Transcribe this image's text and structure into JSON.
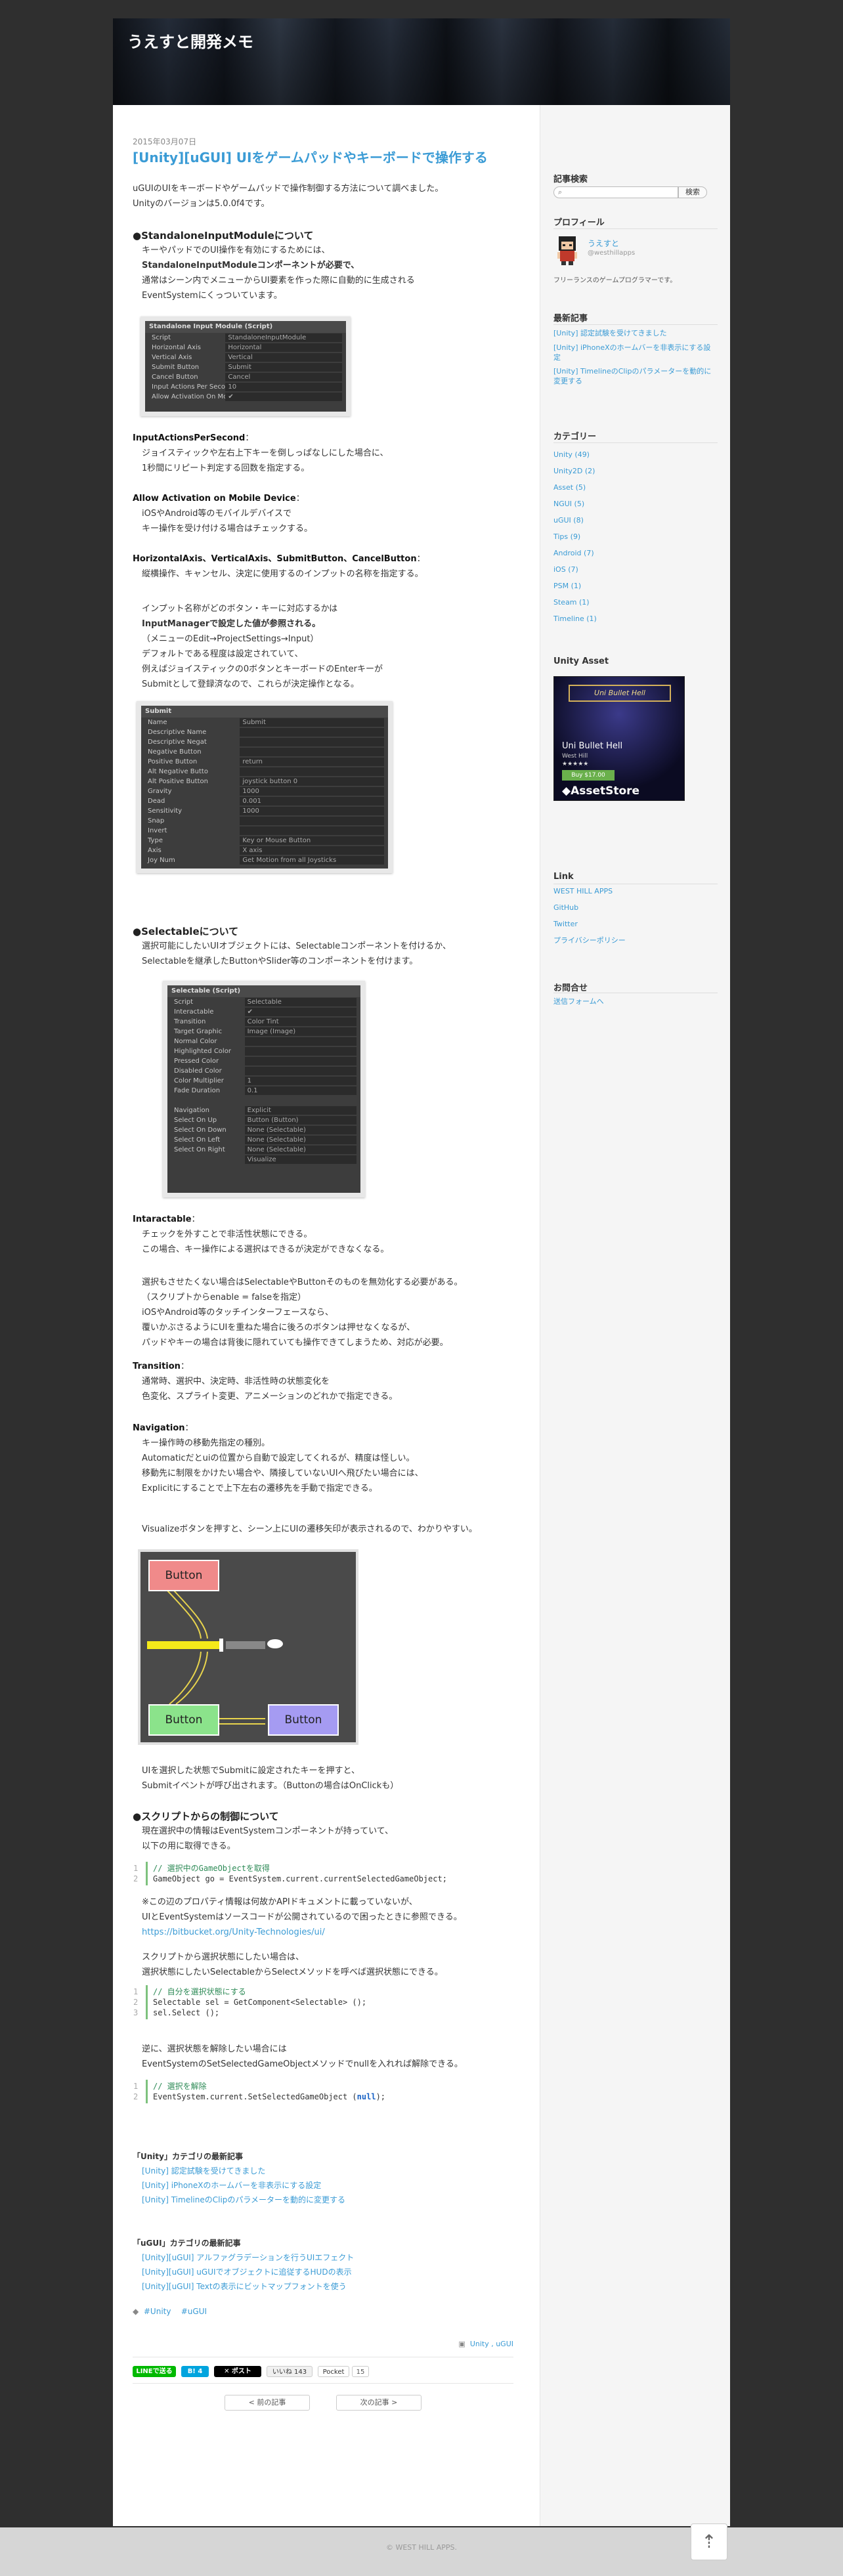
{
  "site": {
    "title": "うえすと開発メモ"
  },
  "post": {
    "date": "2015年03月07日",
    "title": "[Unity][uGUI] UIをゲームパッドやキーボードで操作する",
    "intro": [
      "uGUIのUIをキーボードやゲームパッドで操作制御する方法について調べました。",
      "Unityのバージョンは5.0.0f4です。"
    ],
    "sec1": {
      "heading": "●StandaloneInputModuleについて",
      "lines": [
        "キーやパッドでのUI操作を有効にするためには、",
        "StandaloneInputModuleコンポーネントが必要で、",
        "通常はシーン内でメニューからUI要素を作った際に自動的に生成される",
        "EventSystemにくっついています。"
      ]
    },
    "inspector1": {
      "title": "Standalone Input Module (Script)",
      "rows": [
        [
          "Script",
          "StandaloneInputModule"
        ],
        [
          "Horizontal Axis",
          "Horizontal"
        ],
        [
          "Vertical Axis",
          "Vertical"
        ],
        [
          "Submit Button",
          "Submit"
        ],
        [
          "Cancel Button",
          "Cancel"
        ],
        [
          "Input Actions Per Secon",
          "10"
        ],
        [
          "Allow Activation On Mo",
          "✔"
        ]
      ]
    },
    "desc1": {
      "label": "InputActionsPerSecond",
      "lines": [
        "ジョイスティックや左右上下キーを倒しっぱなしにした場合に、",
        "1秒間にリピート判定する回数を指定する。"
      ]
    },
    "desc2": {
      "label": "Allow Activation on Mobile Device",
      "lines": [
        "iOSやAndroid等のモバイルデバイスで",
        "キー操作を受け付ける場合はチェックする。"
      ]
    },
    "desc3": {
      "label": "HorizontalAxis、VerticalAxis、SubmitButton、CancelButton",
      "lines": [
        "縦横操作、キャンセル、決定に使用するのインプットの名称を指定する。"
      ]
    },
    "desc3b": {
      "lines": [
        "インプット名称がどのボタン・キーに対応するかは",
        "InputManagerで設定した値が参照される。",
        "（メニューのEdit→ProjectSettings→Input）",
        "デフォルトである程度は設定されていて、",
        "例えばジョイスティックの0ボタンとキーボードのEnterキーが",
        "Submitとして登録済なので、これらが決定操作となる。"
      ]
    },
    "inspector2": {
      "title": "Submit",
      "rows": [
        [
          "Name",
          "Submit"
        ],
        [
          "Descriptive Name",
          ""
        ],
        [
          "Descriptive Negat",
          ""
        ],
        [
          "Negative Button",
          ""
        ],
        [
          "Positive Button",
          "return"
        ],
        [
          "Alt Negative Butto",
          ""
        ],
        [
          "Alt Positive Button",
          "joystick button 0"
        ],
        [
          "Gravity",
          "1000"
        ],
        [
          "Dead",
          "0.001"
        ],
        [
          "Sensitivity",
          "1000"
        ],
        [
          "Snap",
          ""
        ],
        [
          "Invert",
          ""
        ],
        [
          "Type",
          "Key or Mouse Button"
        ],
        [
          "Axis",
          "X axis"
        ],
        [
          "Joy Num",
          "Get Motion from all Joysticks"
        ]
      ]
    },
    "sec2": {
      "heading": "●Selectableについて",
      "lines": [
        "選択可能にしたいUIオブジェクトには、Selectableコンポーネントを付けるか、",
        "Selectableを継承したButtonやSlider等のコンポーネントを付けます。"
      ]
    },
    "inspector3": {
      "title": "Selectable (Script)",
      "rows": [
        [
          "Script",
          "Selectable"
        ],
        [
          "Interactable",
          "✔"
        ],
        [
          "Transition",
          "Color Tint"
        ],
        [
          "Target Graphic",
          "Image (Image)"
        ],
        [
          "Normal Color",
          ""
        ],
        [
          "Highlighted Color",
          ""
        ],
        [
          "Pressed Color",
          ""
        ],
        [
          "Disabled Color",
          ""
        ],
        [
          "Color Multiplier",
          "1"
        ],
        [
          "Fade Duration",
          "0.1"
        ],
        [
          "",
          ""
        ],
        [
          "Navigation",
          "Explicit"
        ],
        [
          "Select On Up",
          "Button (Button)"
        ],
        [
          "Select On Down",
          "None (Selectable)"
        ],
        [
          "Select On Left",
          "None (Selectable)"
        ],
        [
          "Select On Right",
          "None (Selectable)"
        ],
        [
          "",
          "Visualize"
        ]
      ]
    },
    "desc4": {
      "label": "Intaractable",
      "lines": [
        "チェックを外すことで非活性状態にできる。",
        "この場合、キー操作による選択はできるが決定ができなくなる。"
      ]
    },
    "desc4b": {
      "lines": [
        "選択もさせたくない場合はSelectableやButtonそのものを無効化する必要がある。",
        "（スクリプトからenable = falseを指定）",
        "iOSやAndroid等のタッチインターフェースなら、",
        "覆いかぶさるようにUIを重ねた場合に後ろのボタンは押せなくなるが、",
        "パッドやキーの場合は背後に隠れていても操作できてしまうため、対応が必要。"
      ]
    },
    "desc5": {
      "label": "Transition",
      "lines": [
        "通常時、選択中、決定時、非活性時の状態変化を",
        "色変化、スプライト変更、アニメーションのどれかで指定できる。"
      ]
    },
    "desc6": {
      "label": "Navigation",
      "lines": [
        "キー操作時の移動先指定の種別。",
        "Automaticだとuiの位置から自動で設定してくれるが、精度は怪しい。",
        "移動先に制限をかけたい場合や、隣接していないUIへ飛びたい場合には、",
        "Explicitにすることで上下左右の遷移先を手動で指定できる。"
      ]
    },
    "desc6b": {
      "lines": [
        "Visualizeボタンを押すと、シーン上にUIの遷移矢印が表示されるので、わかりやすい。"
      ]
    },
    "diagram": {
      "btn1": "Button",
      "btn2": "Button",
      "btn3": "Button"
    },
    "desc7": {
      "lines": [
        "UIを選択した状態でSubmitに設定されたキーを押すと、",
        "Submitイベントが呼び出されます。（Buttonの場合はOnClickも）"
      ]
    },
    "sec3": {
      "heading": "●スクリプトからの制御について",
      "lines": [
        "現在選択中の情報はEventSystemコンポーネントが持っていて、",
        "以下の用に取得できる。"
      ]
    },
    "code1": {
      "l1": "// 選択中のGameObjectを取得",
      "l2": "GameObject go = EventSystem.current.currentSelectedGameObject;"
    },
    "note1": {
      "lines": [
        "※この辺のプロパティ情報は何故かAPIドキュメントに載っていないが、",
        "UIとEventSystemはソースコードが公開されているので困ったときに参照できる。"
      ],
      "url": "https://bitbucket.org/Unity-Technologies/ui/"
    },
    "sec3b": {
      "lines": [
        "スクリプトから選択状態にしたい場合は、",
        "選択状態にしたいSelectableからSelectメソッドを呼べば選択状態にできる。"
      ]
    },
    "code2": {
      "l1": "// 自分を選択状態にする",
      "l2": "Selectable sel = GetComponent<Selectable> ();",
      "l3": "sel.Select ();"
    },
    "sec3c": {
      "lines": [
        "逆に、選択状態を解除したい場合には",
        "EventSystemのSetSelectedGameObjectメソッドでnullを入れれば解除できる。"
      ]
    },
    "code3": {
      "l1": "// 選択を解除",
      "l2a": "EventSystem.current.SetSelectedGameObject (",
      "l2b": "null",
      "l2c": ");"
    },
    "related_unity": {
      "heading": "「Unity」カテゴリの最新記事",
      "items": [
        "[Unity] 認定試験を受けてきました",
        "[Unity] iPhoneXのホームバーを非表示にする設定",
        "[Unity] TimelineのClipのパラメーターを動的に変更する"
      ]
    },
    "related_ugui": {
      "heading": "「uGUI」カテゴリの最新記事",
      "items": [
        "[Unity][uGUI] アルファグラデーションを行うUIエフェクト",
        "[Unity][uGUI] uGUIでオブジェクトに追従するHUDの表示",
        "[Unity][uGUI] Textの表示にビットマップフォントを使う"
      ]
    },
    "tags": [
      "#Unity",
      "#uGUI"
    ],
    "categories": "Unity , uGUI",
    "share": {
      "line": "LINEで送る",
      "hatena": "B! 4",
      "x": "✕ ポスト",
      "likes": "いいね 143",
      "pocket": "Pocket",
      "pocket_count": "15"
    },
    "nav": {
      "prev": "< 前の記事",
      "next": "次の記事 >"
    }
  },
  "sidebar": {
    "search": {
      "heading": "記事検索",
      "placeholder": "",
      "button": "検索"
    },
    "profile": {
      "heading": "プロフィール",
      "name": "うえすと",
      "handle": "@westhillapps",
      "desc": "フリーランスのゲームプログラマーです。"
    },
    "recent": {
      "heading": "最新記事",
      "items": [
        "[Unity] 認定試験を受けてきました",
        "[Unity] iPhoneXのホームバーを非表示にする設定",
        "[Unity] TimelineのClipのパラメーターを動的に変更する"
      ]
    },
    "categories": {
      "heading": "カテゴリー",
      "items": [
        "Unity (49)",
        "Unity2D (2)",
        "Asset (5)",
        "NGUI (5)",
        "uGUI (8)",
        "Tips (9)",
        "Android (7)",
        "iOS (7)",
        "PSM (1)",
        "Steam (1)",
        "Timeline (1)"
      ]
    },
    "asset": {
      "heading": "Unity Asset",
      "banner": "Uni Bullet Hell",
      "publisher": "West Hill",
      "stars": "★★★★★",
      "price": "Buy $17.00",
      "store": "AssetStore"
    },
    "links": {
      "heading": "Link",
      "items": [
        "WEST HILL APPS",
        "GitHub",
        "Twitter",
        "プライバシーポリシー"
      ]
    },
    "contact": {
      "heading": "お問合せ",
      "link": "送信フォームへ"
    }
  },
  "footer": {
    "copyright": "© WEST HILL APPS.",
    "totop": "⇡"
  },
  "colors": {
    "accent": "#3a9bd5",
    "bg": "#2f2f2f",
    "code_border": "#7ec27e"
  }
}
